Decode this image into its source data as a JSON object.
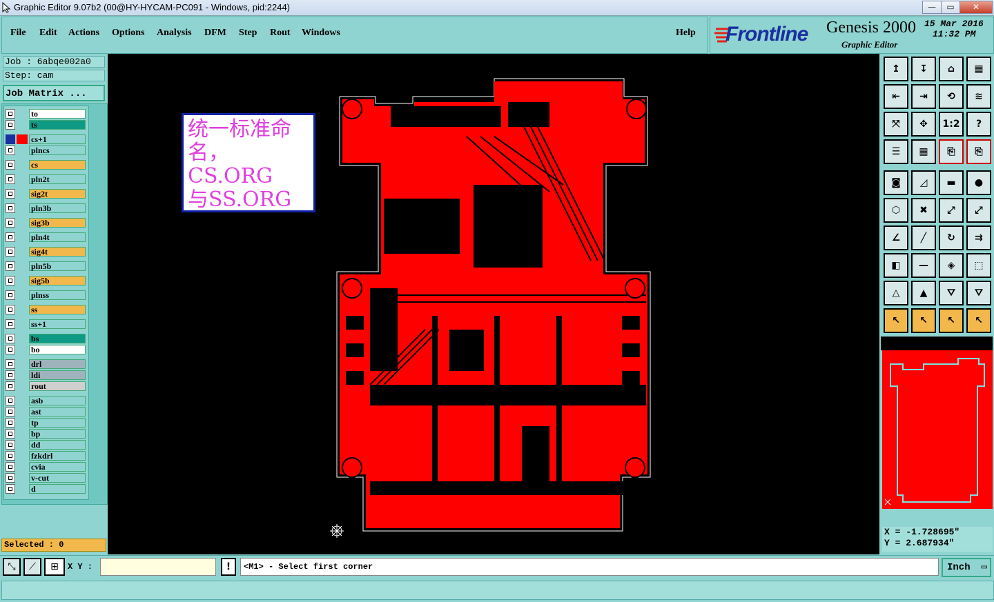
{
  "window": {
    "title": "Graphic Editor 9.07b2 (00@HY-HYCAM-PC091 - Windows, pid:2244)",
    "buttons": [
      "—",
      "▭",
      "✕"
    ]
  },
  "menu": {
    "items": [
      "File",
      "Edit",
      "Actions",
      "Options",
      "Analysis",
      "DFM",
      "Step",
      "Rout",
      "Windows"
    ],
    "help": "Help"
  },
  "brand": {
    "logo": "Frontline",
    "product": "Genesis 2000",
    "subtitle": "Graphic Editor",
    "date": "15 Mar 2016",
    "time": "11:32 PM"
  },
  "job": {
    "job_label": "Job : 6abqe002a0",
    "step_label": "Step: cam",
    "matrix_button": "Job Matrix ..."
  },
  "layers": [
    {
      "name": "to",
      "color": "#ffffff"
    },
    {
      "name": "ts",
      "color": "#0f9a85"
    },
    {
      "name": "cs+1",
      "color": "#8fd4d0",
      "active": true
    },
    {
      "name": "plncs",
      "color": "#8fd4d0"
    },
    {
      "name": "cs",
      "color": "#f3b84b"
    },
    {
      "name": "pln2t",
      "color": "#8fd4d0"
    },
    {
      "name": "sig2t",
      "color": "#f3b84b"
    },
    {
      "name": "pln3b",
      "color": "#8fd4d0"
    },
    {
      "name": "sig3b",
      "color": "#f3b84b"
    },
    {
      "name": "pln4t",
      "color": "#8fd4d0"
    },
    {
      "name": "sig4t",
      "color": "#f3b84b"
    },
    {
      "name": "pln5b",
      "color": "#8fd4d0"
    },
    {
      "name": "sig5b",
      "color": "#f3b84b"
    },
    {
      "name": "plnss",
      "color": "#8fd4d0"
    },
    {
      "name": "ss",
      "color": "#f3b84b"
    },
    {
      "name": "ss+1",
      "color": "#8fd4d0"
    },
    {
      "name": "bs",
      "color": "#0f9a85"
    },
    {
      "name": "bo",
      "color": "#ffffff"
    },
    {
      "name": "drl",
      "color": "#9fb3bc"
    },
    {
      "name": "ldi",
      "color": "#9fb3bc"
    },
    {
      "name": "rout",
      "color": "#d0d0d0"
    },
    {
      "name": "asb",
      "color": "#8fd4d0"
    },
    {
      "name": "ast",
      "color": "#8fd4d0"
    },
    {
      "name": "tp",
      "color": "#8fd4d0"
    },
    {
      "name": "bp",
      "color": "#8fd4d0"
    },
    {
      "name": "dd",
      "color": "#8fd4d0"
    },
    {
      "name": "fzkdrl",
      "color": "#8fd4d0"
    },
    {
      "name": "cvia",
      "color": "#8fd4d0"
    },
    {
      "name": "v-cut",
      "color": "#8fd4d0"
    },
    {
      "name": "d",
      "color": "#8fd4d0"
    }
  ],
  "selected": "Selected : 0",
  "note": {
    "lines": [
      "统一标准命",
      "名，CS.ORG",
      "与SS.ORG"
    ]
  },
  "coords": {
    "x": "X = -1.728695\"",
    "y": "Y = 2.687934\""
  },
  "bottom": {
    "xy_label": "X Y :",
    "xy_value": "",
    "message": "<M1> - Select first corner",
    "units": "Inch"
  },
  "colors": {
    "board": "#ff0000",
    "panel": "#8fd4d0",
    "canvas": "#000000"
  }
}
